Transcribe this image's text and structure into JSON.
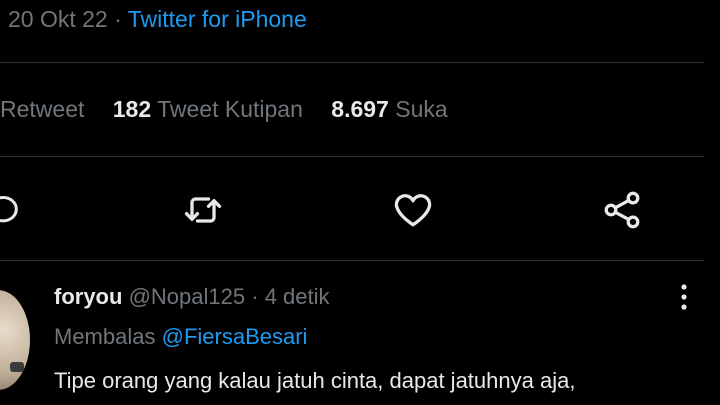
{
  "tweet_meta": {
    "date": "20 Okt 22",
    "separator": "·",
    "client": "Twitter for iPhone"
  },
  "stats": {
    "retweet_label": "Retweet",
    "quote_count": "182",
    "quote_label": "Tweet Kutipan",
    "like_count": "8.697",
    "like_label": "Suka"
  },
  "actions": [
    "reply-icon",
    "retweet-icon",
    "heart-icon",
    "share-icon"
  ],
  "reply": {
    "name": "foryou",
    "handle": "@Nopal125",
    "separator": "·",
    "time": "4 detik",
    "replying_prefix": "Membalas",
    "replying_to": "@FiersaBesari",
    "text": "Tipe orang yang kalau jatuh cinta, dapat jatuhnya aja,"
  },
  "colors": {
    "background": "#000000",
    "text": "#e7e9ea",
    "muted": "#71767b",
    "accent": "#1d9bf0",
    "divider": "#2f3336"
  }
}
